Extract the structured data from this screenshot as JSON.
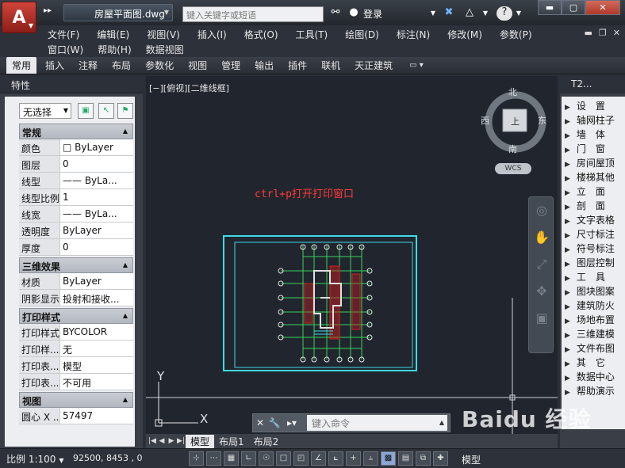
{
  "window": {
    "doc_title": "房屋平面图.dwg",
    "search_placeholder": "键入关键字或短语",
    "login_label": "登录",
    "app_letter": "A",
    "win_min": "▬",
    "win_max": "▢",
    "win_close": "✕"
  },
  "menu": {
    "row1": [
      "文件(F)",
      "编辑(E)",
      "视图(V)",
      "插入(I)",
      "格式(O)",
      "工具(T)",
      "绘图(D)",
      "标注(N)",
      "修改(M)",
      "参数(P)"
    ],
    "row2": [
      "窗口(W)",
      "帮助(H)",
      "数据视图"
    ]
  },
  "ribbon_tabs": [
    "常用",
    "插入",
    "注释",
    "布局",
    "参数化",
    "视图",
    "管理",
    "输出",
    "插件",
    "联机",
    "天正建筑"
  ],
  "properties": {
    "title": "特性",
    "selection": "无选择",
    "sections": [
      {
        "name": "常规",
        "rows": [
          {
            "label": "颜色",
            "value": "□ ByLayer"
          },
          {
            "label": "图层",
            "value": "0"
          },
          {
            "label": "线型",
            "value": "—— ByLa..."
          },
          {
            "label": "线型比例",
            "value": "1"
          },
          {
            "label": "线宽",
            "value": "—— ByLa..."
          },
          {
            "label": "透明度",
            "value": "ByLayer"
          },
          {
            "label": "厚度",
            "value": "0"
          }
        ]
      },
      {
        "name": "三维效果",
        "rows": [
          {
            "label": "材质",
            "value": "ByLayer"
          },
          {
            "label": "阴影显示",
            "value": "投射和接收..."
          }
        ]
      },
      {
        "name": "打印样式",
        "rows": [
          {
            "label": "打印样式",
            "value": "BYCOLOR"
          },
          {
            "label": "打印样...",
            "value": "无"
          },
          {
            "label": "打印表...",
            "value": "模型"
          },
          {
            "label": "打印表...",
            "value": "不可用"
          }
        ]
      },
      {
        "name": "视图",
        "rows": [
          {
            "label": "圆心 X ...",
            "value": "57497"
          }
        ]
      }
    ]
  },
  "drawing": {
    "view_label": "[−][俯视][二维线框]",
    "note": "ctrl+p打开打印窗口",
    "compass": {
      "north": "北",
      "south": "南",
      "east": "东",
      "west": "西",
      "center": "上",
      "wcs": "WCS"
    },
    "ucs_x": "X",
    "ucs_y": "Y",
    "command_placeholder": "键入命令"
  },
  "layout_tabs": [
    "模型",
    "布局1",
    "布局2"
  ],
  "tool_panel": {
    "title": "T2...",
    "items": [
      "设　置",
      "轴网柱子",
      "墙　体",
      "门　窗",
      "房间屋顶",
      "楼梯其他",
      "立　面",
      "剖　面",
      "文字表格",
      "尺寸标注",
      "符号标注",
      "图层控制",
      "工　具",
      "图块图案",
      "建筑防火",
      "场地布置",
      "三维建模",
      "文件布图",
      "其　它",
      "数据中心",
      "帮助演示"
    ]
  },
  "status": {
    "scale": "比例 1:100",
    "coords": "92500, 8453 , 0",
    "model": "模型"
  },
  "watermark": "Baidu 经验",
  "colors": {
    "canvas": "#21262e",
    "wall": "#e0e0e0",
    "grid_green": "#36d35a",
    "hatch_red": "#d42020",
    "frame_cyan": "#3fd8e8",
    "note_red": "#ff3b3b"
  }
}
